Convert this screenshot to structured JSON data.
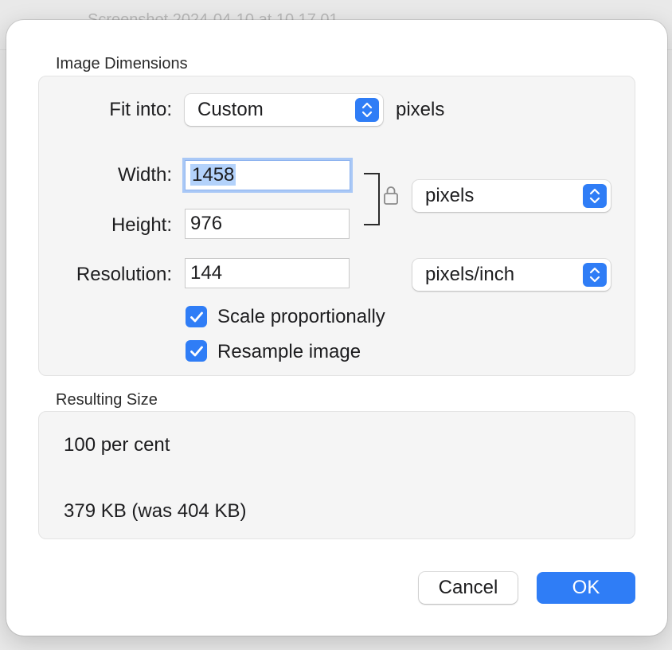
{
  "backdrop": {
    "title": "Screenshot 2024-04-10 at 10.17.01"
  },
  "image_dimensions": {
    "section_label": "Image Dimensions",
    "fit_into": {
      "label": "Fit into:",
      "value": "Custom",
      "unit": "pixels"
    },
    "width": {
      "label": "Width:",
      "value": "1458"
    },
    "height": {
      "label": "Height:",
      "value": "976"
    },
    "size_unit": {
      "value": "pixels"
    },
    "resolution": {
      "label": "Resolution:",
      "value": "144",
      "unit": "pixels/inch"
    },
    "scale_proportionally": {
      "label": "Scale proportionally",
      "checked": true
    },
    "resample_image": {
      "label": "Resample image",
      "checked": true
    }
  },
  "resulting_size": {
    "section_label": "Resulting Size",
    "percent": "100 per cent",
    "file_size": "379 KB (was 404 KB)"
  },
  "buttons": {
    "cancel": "Cancel",
    "ok": "OK"
  },
  "colors": {
    "accent": "#2f7df6",
    "selection": "#b3d2fb",
    "group_bg": "#f5f5f5"
  }
}
